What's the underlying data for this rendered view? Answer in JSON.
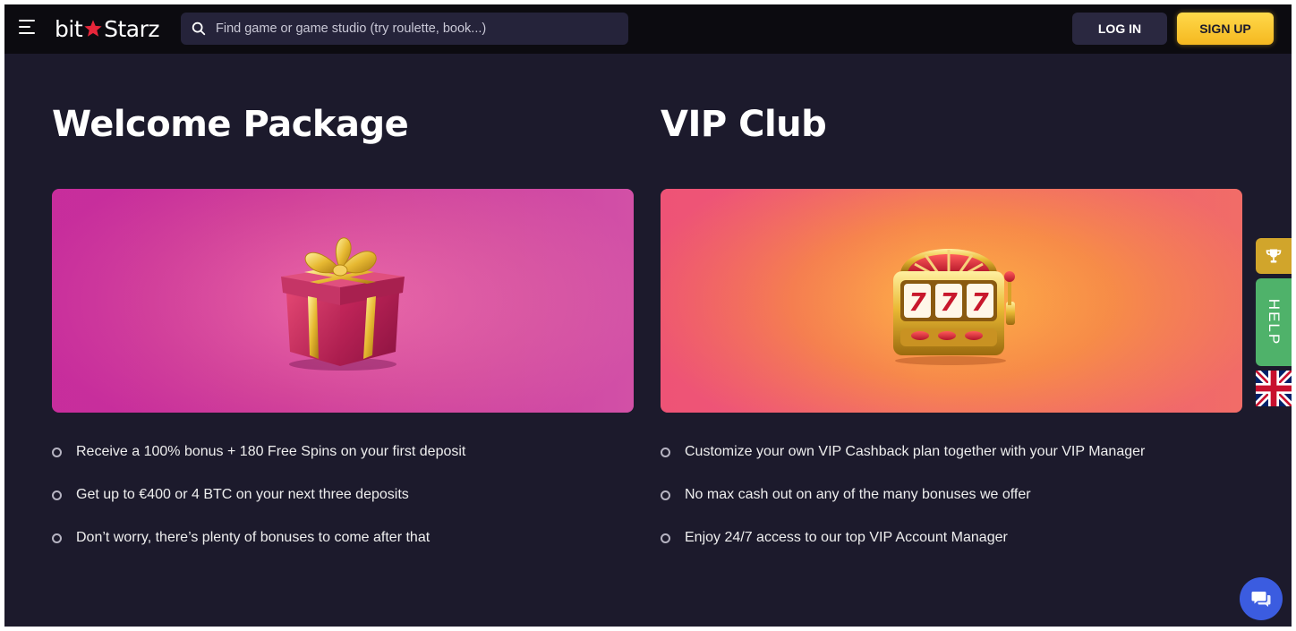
{
  "header": {
    "logo_left": "bit",
    "logo_right": "Starz",
    "search_placeholder": "Find game or game studio (try roulette, book...)",
    "login_label": "LOG IN",
    "signup_label": "SIGN UP"
  },
  "welcome": {
    "title": "Welcome Package",
    "bullets": [
      "Receive a 100% bonus + 180 Free Spins on your first deposit",
      "Get up to €400 or 4 BTC on your next three deposits",
      "Don’t worry, there’s plenty of bonuses to come after that"
    ]
  },
  "vip": {
    "title": "VIP Club",
    "bullets": [
      "Customize your own VIP Cashback plan together with your VIP Manager",
      "No max cash out on any of the many bonuses we offer",
      "Enjoy 24/7 access to our top VIP Account Manager"
    ]
  },
  "side": {
    "help_label": "HELP"
  },
  "icons": {
    "menu": "hamburger-menu-icon",
    "search": "search-icon",
    "gift": "gift-box-illustration",
    "slot": "slot-machine-illustration",
    "trophy": "trophy-icon",
    "flag": "uk-flag-icon",
    "chat": "chat-bubble-icon"
  },
  "colors": {
    "background": "#1c1a2c",
    "header": "#0c0b10",
    "accent_yellow": "#ffd94a",
    "help_green": "#4fb26a",
    "chat_blue": "#3b5ce0"
  }
}
